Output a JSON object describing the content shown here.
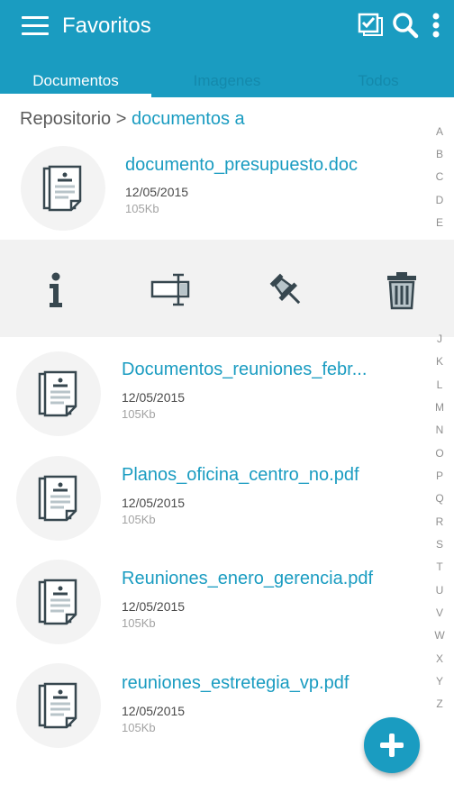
{
  "appbar": {
    "title": "Favoritos",
    "icons": [
      "menu-icon",
      "multi-select-icon",
      "search-icon",
      "more-vert-icon"
    ]
  },
  "tabs": [
    {
      "label": "Documentos",
      "active": true
    },
    {
      "label": "Imagenes",
      "active": false
    },
    {
      "label": "Todos",
      "active": false
    }
  ],
  "breadcrumb": {
    "root": "Repositorio",
    "separator": ">",
    "current": "documentos a"
  },
  "files": [
    {
      "name": "documento_presupuesto.doc",
      "date": "12/05/2015",
      "size": "105Kb"
    },
    {
      "name": "Documentos_reuniones_febr...",
      "date": "12/05/2015",
      "size": "105Kb"
    },
    {
      "name": "Planos_oficina_centro_no.pdf",
      "date": "12/05/2015",
      "size": "105Kb"
    },
    {
      "name": "Reuniones_enero_gerencia.pdf",
      "date": "12/05/2015",
      "size": "105Kb"
    },
    {
      "name": "reuniones_estretegia_vp.pdf",
      "date": "12/05/2015",
      "size": "105Kb"
    }
  ],
  "item_actions": [
    "info-icon",
    "rename-icon",
    "pin-icon",
    "delete-icon"
  ],
  "alphabet_top": [
    "A",
    "B",
    "C",
    "D",
    "E"
  ],
  "alphabet_bottom": [
    "J",
    "K",
    "L",
    "M",
    "N",
    "O",
    "P",
    "Q",
    "R",
    "S",
    "T",
    "U",
    "V",
    "W",
    "X",
    "Y",
    "Z"
  ],
  "colors": {
    "primary": "#1a9cc1",
    "inactive_tab": "#1489ab",
    "action_bar_bg": "#f2f2f2",
    "icon_dark": "#37474f"
  }
}
